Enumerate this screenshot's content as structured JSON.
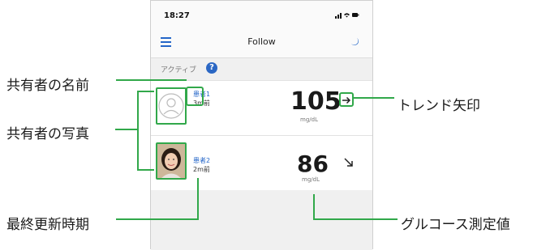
{
  "status": {
    "time": "18:27"
  },
  "nav": {
    "title": "Follow"
  },
  "section": {
    "label": "アクティブ",
    "help": "?"
  },
  "patients": [
    {
      "name": "患者1",
      "ago": "3m前",
      "value": "105",
      "unit": "mg/dL",
      "trend": "right"
    },
    {
      "name": "患者2",
      "ago": "2m前",
      "value": "86",
      "unit": "mg/dL",
      "trend": "down-right"
    }
  ],
  "annotations": {
    "name": "共有者の名前",
    "photo": "共有者の写真",
    "last_update": "最終更新時期",
    "trend": "トレンド矢印",
    "glucose": "グルコース測定値"
  },
  "colors": {
    "accent": "#2466c8",
    "highlight": "#31a84a"
  }
}
